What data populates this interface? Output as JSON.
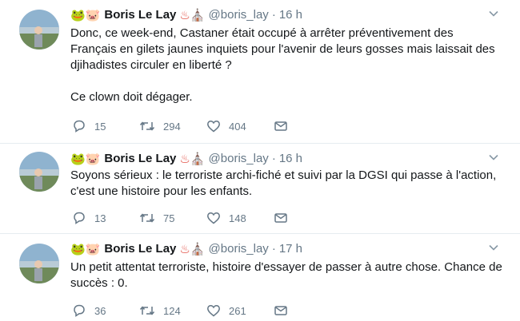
{
  "tweets": [
    {
      "name": "Boris Le Lay",
      "handle": "@boris_lay",
      "separator": "·",
      "time": "16 h",
      "paragraphs": [
        "Donc, ce week-end, Castaner était occupé à arrêter préventivement des Français en gilets jaunes inquiets pour l'avenir de leurs gosses mais laissait des djihadistes circuler en liberté ?",
        "Ce clown doit dégager."
      ],
      "replies": "15",
      "retweets": "294",
      "likes": "404"
    },
    {
      "name": "Boris Le Lay",
      "handle": "@boris_lay",
      "separator": "·",
      "time": "16 h",
      "paragraphs": [
        "Soyons sérieux : le terroriste archi-fiché et suivi par la DGSI qui passe à l'action, c'est une histoire pour les enfants."
      ],
      "replies": "13",
      "retweets": "75",
      "likes": "148"
    },
    {
      "name": "Boris Le Lay",
      "handle": "@boris_lay",
      "separator": "·",
      "time": "17 h",
      "paragraphs": [
        "Un petit attentat terroriste, histoire d'essayer de passer à autre chose. Chance de succès : 0."
      ],
      "replies": "36",
      "retweets": "124",
      "likes": "261"
    }
  ],
  "emojis": {
    "frog": "🐸",
    "pig": "🐷",
    "hot_springs": "♨",
    "tower": "⛪"
  },
  "icons": [
    "reply-icon",
    "retweet-icon",
    "like-icon",
    "message-icon",
    "chevron-down-icon"
  ],
  "colors": {
    "text": "#14171a",
    "muted": "#657786",
    "divider": "#e6ecf0"
  }
}
